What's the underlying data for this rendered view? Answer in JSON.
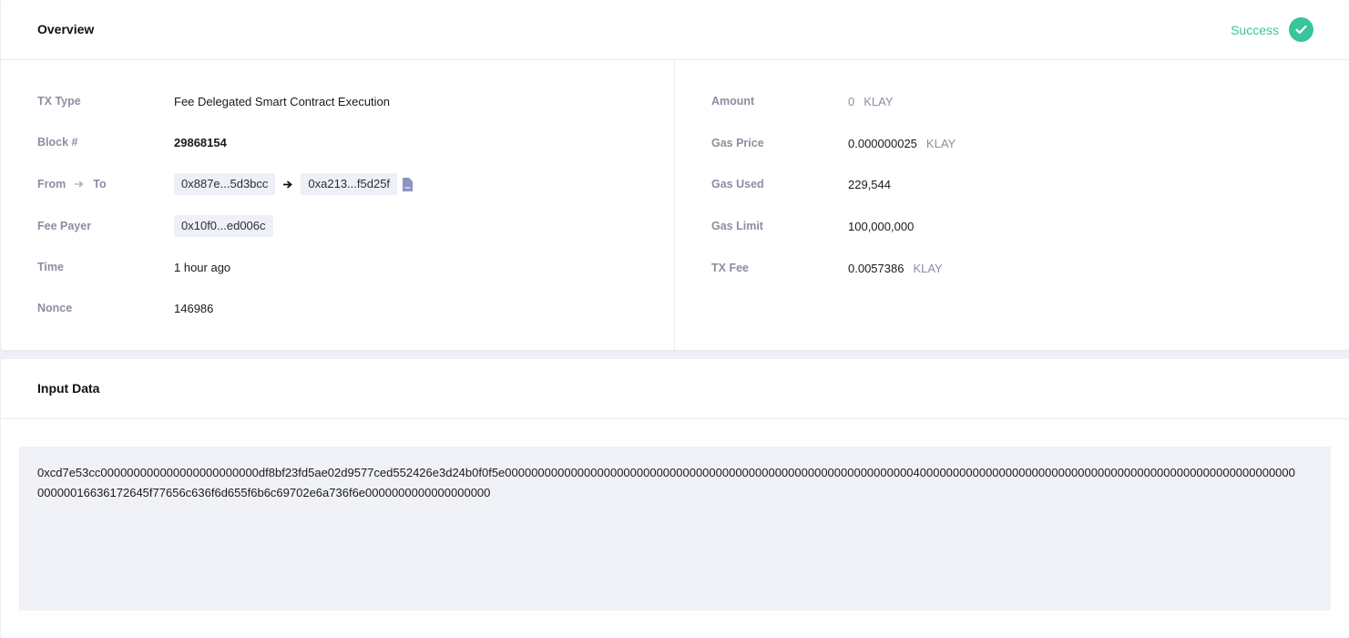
{
  "overview": {
    "title": "Overview",
    "status": {
      "label": "Success",
      "color": "#3ac49c",
      "icon": "check-circle-icon"
    },
    "left": {
      "tx_type": {
        "label": "TX Type",
        "value": "Fee Delegated Smart Contract Execution"
      },
      "block": {
        "label": "Block #",
        "value": "29868154"
      },
      "from_to": {
        "label_from": "From",
        "label_to": "To",
        "from": "0x887e...5d3bcc",
        "to": "0xa213...f5d25f"
      },
      "fee_payer": {
        "label": "Fee Payer",
        "value": "0x10f0...ed006c"
      },
      "time": {
        "label": "Time",
        "value": "1 hour ago"
      },
      "nonce": {
        "label": "Nonce",
        "value": "146986"
      }
    },
    "right": {
      "amount": {
        "label": "Amount",
        "value": "0",
        "unit": "KLAY"
      },
      "gas_price": {
        "label": "Gas Price",
        "value": "0.000000025",
        "unit": "KLAY"
      },
      "gas_used": {
        "label": "Gas Used",
        "value": "229,544"
      },
      "gas_limit": {
        "label": "Gas Limit",
        "value": "100,000,000"
      },
      "tx_fee": {
        "label": "TX Fee",
        "value": "0.0057386",
        "unit": "KLAY"
      }
    }
  },
  "input_data": {
    "title": "Input Data",
    "line1": "0xcd7e53cc000000000000000000000000df8bf23fd5ae02d9577ced552426e3d24b0f0f5e000000000000000000000000000000000000000000000000000000000000004000000000000000000000000000000000000000000000000000000000",
    "line2": "00000016636172645f77656c636f6d655f6b6c69702e6a736f6e0000000000000000000"
  }
}
